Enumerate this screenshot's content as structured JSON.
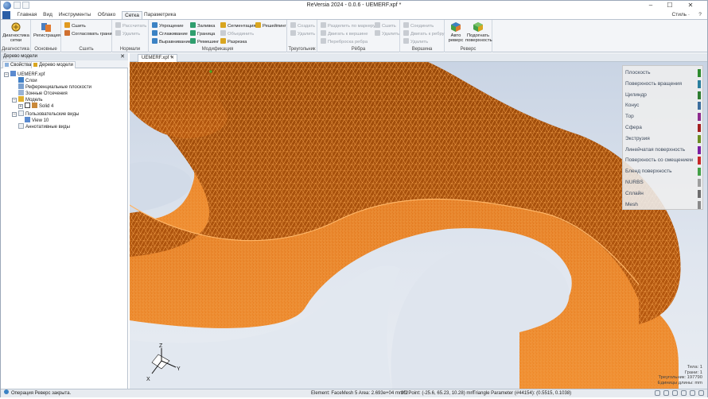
{
  "window": {
    "title": "ReVersia 2024 - 0.0.6 - UEMERF.xpf *",
    "controls": [
      "–",
      "☐",
      "✕"
    ],
    "help": "?"
  },
  "ribbon": {
    "file_tab": "",
    "tabs": [
      "Главная",
      "Вид",
      "Инструменты",
      "Облако",
      "Сетка",
      "Параметрика"
    ],
    "active_tab": "Сетка",
    "style_label": "Стиль ·",
    "groups": {
      "diagnostics": {
        "label": "Диагностика",
        "btn": "Диагностика сетки"
      },
      "basic": {
        "label": "Основные",
        "btn": "Регистрация"
      },
      "sew": {
        "label": "Сшить",
        "sew": "Сшить",
        "match": "Согласовать грани"
      },
      "normals": {
        "label": "Нормали",
        "recalc": "Рассчитать",
        "del": "Удалить"
      },
      "modify": {
        "label": "Модификация",
        "simplify": "Упрощение",
        "smooth": "Сглаживание",
        "align": "Выравнивание",
        "fill": "Заливка",
        "border": "Граница",
        "remesh": "Ремешинг",
        "segment": "Сегментация",
        "merge": "Объединить",
        "cut": "Разрезка",
        "meshing": "Решейпинг"
      },
      "triangles": {
        "label": "Треугольник",
        "create": "Создать",
        "del": "Удалить"
      },
      "edges": {
        "label": "Рёбра",
        "split": "Разделить по маркеру",
        "move": "Двигать к вершине",
        "flip": "Переброска ребра",
        "sew": "Сшить",
        "del": "Удалить"
      },
      "vertex": {
        "label": "Вершина",
        "join": "Соединить",
        "move_edge": "Двигать к ребру",
        "del": "Удалить"
      },
      "reverse": {
        "label": "Реверс",
        "auto": "Авто реверс",
        "fit": "Подогнать поверхность"
      }
    }
  },
  "left_panel": {
    "title": "Дерево модели",
    "close": "✕",
    "tabs": [
      "Свойства",
      "Дерево модели"
    ],
    "tree": [
      {
        "label": "UEMERF.xpf",
        "level": 0,
        "expander": "–"
      },
      {
        "label": "Слои",
        "level": 1
      },
      {
        "label": "Референциальные плоскости",
        "level": 1
      },
      {
        "label": "Зонные Отсечения",
        "level": 1
      },
      {
        "label": "Модель",
        "level": 1,
        "expander": "–"
      },
      {
        "label": "Solid 4",
        "level": 2,
        "expander": "+"
      },
      {
        "label": "Пользовательские виды",
        "level": 1,
        "expander": "–"
      },
      {
        "label": "View 10",
        "level": 2
      },
      {
        "label": "Аннотативные виды",
        "level": 1
      }
    ]
  },
  "document": {
    "tab": "UEMERF.xpf *",
    "close": "✕"
  },
  "legend": [
    {
      "label": "Плоскость",
      "color": "#2e8b2e"
    },
    {
      "label": "Поверхность вращения",
      "color": "#2a7f9e"
    },
    {
      "label": "Цилиндр",
      "color": "#2e7d32"
    },
    {
      "label": "Конус",
      "color": "#3d6e9e"
    },
    {
      "label": "Тор",
      "color": "#8e2b8e"
    },
    {
      "label": "Сфера",
      "color": "#a32020"
    },
    {
      "label": "Экструзия",
      "color": "#6b8e23"
    },
    {
      "label": "Линейчатая поверхность",
      "color": "#7b1fa2"
    },
    {
      "label": "Поверхность со смещением",
      "color": "#c62828"
    },
    {
      "label": "Бленд поверхность",
      "color": "#43a047"
    },
    {
      "label": "NURBS",
      "color": "#9e9e9e"
    },
    {
      "label": "Сплайн",
      "color": "#6d6d6d"
    },
    {
      "label": "Mesh",
      "color": "#8a8a8a"
    }
  ],
  "stats": {
    "bodies": "Тела: 1",
    "faces": "Грани: 1",
    "triangles": "Треугольник: 197790",
    "units": "Единицы длины: mm"
  },
  "axes": {
    "x": "X",
    "y": "Y",
    "z": "Z"
  },
  "status": {
    "message": "Операция Реверс закрыта.",
    "element": "Element: FaceMesh 5 Area: 2.693e+04 mm^2",
    "point": "3D Point: (-25.6, 65.23, 10.28) mm",
    "triangle": "Triangle Parameter (#44154): (0.5515, 0.1038)"
  }
}
